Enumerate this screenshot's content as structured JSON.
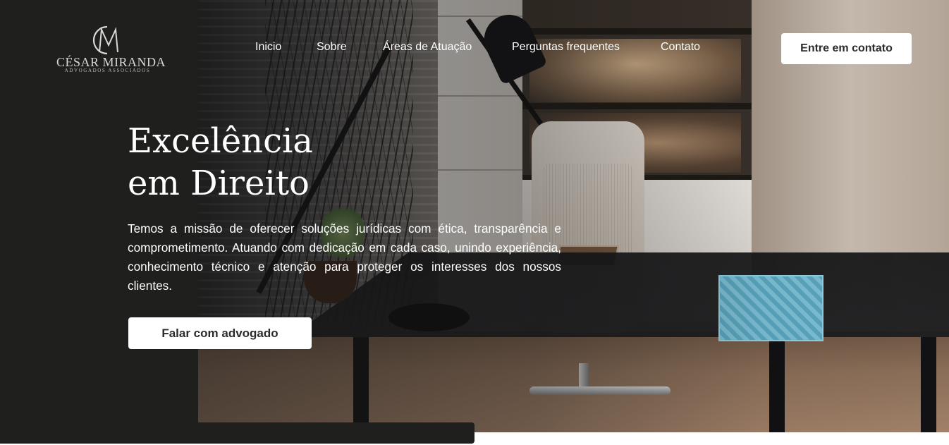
{
  "logo": {
    "name": "CÉSAR MIRANDA",
    "subtitle": "ADVOGADOS ASSOCIADOS"
  },
  "nav": {
    "items": [
      {
        "label": "Inicio"
      },
      {
        "label": "Sobre"
      },
      {
        "label": "Áreas de Atuação"
      },
      {
        "label": "Perguntas frequentes"
      },
      {
        "label": "Contato"
      }
    ],
    "cta_label": "Entre em contato"
  },
  "hero": {
    "title_line1": "Excelência",
    "title_line2": "em Direito",
    "description": "Temos a missão de oferecer soluções jurídicas com ética, transparência e comprometimento. Atuando com dedicação em cada caso, unindo experiência, conhecimento técnico e atenção para proteger os interesses dos nossos clientes.",
    "cta_label": "Falar com advogado"
  },
  "colors": {
    "dark_panel": "#1f1f1e",
    "button_bg": "#ffffff",
    "button_text": "#2b2b2b",
    "text_on_dark": "#ffffff"
  }
}
